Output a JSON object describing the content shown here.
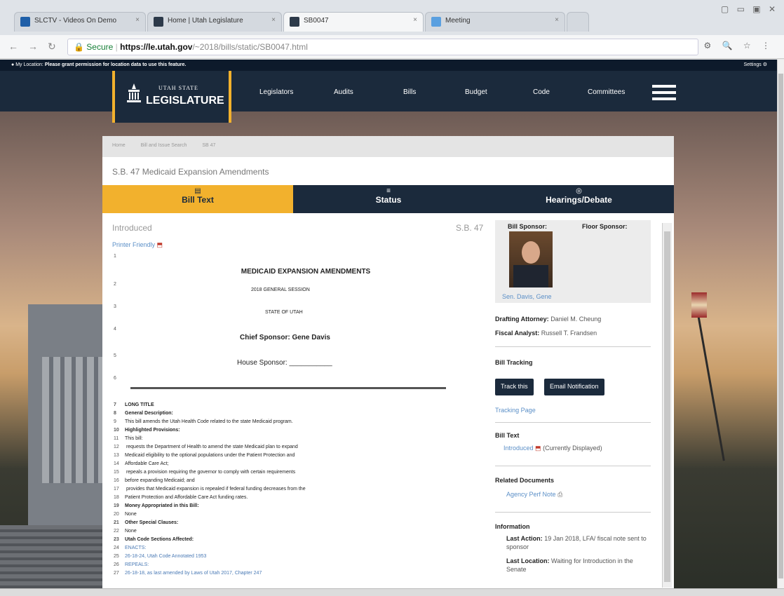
{
  "browser": {
    "tabs": [
      {
        "label": "SLCTV - Videos On Demo",
        "fav": "tv-icon"
      },
      {
        "label": "Home | Utah Legislature",
        "fav": "legislature-icon"
      },
      {
        "label": "SB0047",
        "fav": "legislature-icon"
      },
      {
        "label": "Meeting",
        "fav": "meeting-icon"
      }
    ],
    "url": {
      "secure": "Secure",
      "domain": "https://le.utah.gov",
      "path": "/~2018/bills/static/SB0047.html"
    }
  },
  "location_bar": {
    "label": "My Location:",
    "text": "Please grant permission for location data to use this feature.",
    "settings": "Settings"
  },
  "header": {
    "logo_top": "UTAH STATE",
    "logo_main": "LEGISLATURE",
    "menu": [
      "Legislators",
      "Audits",
      "Bills",
      "Budget",
      "Code",
      "Committees"
    ]
  },
  "breadcrumb": [
    "Home",
    "Bill and Issue Search",
    "SB 47"
  ],
  "bill": {
    "title": "S.B. 47 Medicaid Expansion Amendments"
  },
  "tabs": [
    {
      "label": "Bill Text",
      "icon": "document-icon"
    },
    {
      "label": "Status",
      "icon": "list-icon"
    },
    {
      "label": "Hearings/Debate",
      "icon": "globe-icon"
    }
  ],
  "content": {
    "status": "Introduced",
    "number": "S.B. 47",
    "printer": "Printer Friendly",
    "title": "MEDICAID EXPANSION AMENDMENTS",
    "session": "2018 GENERAL SESSION",
    "state": "STATE OF UTAH",
    "chief": "Chief Sponsor: Gene Davis",
    "house": "House Sponsor: ___________",
    "long_title": [
      {
        "n": "7",
        "t": "LONG TITLE",
        "b": true
      },
      {
        "n": "8",
        "t": "General Description:",
        "b": true
      },
      {
        "n": "9",
        "t": "This bill amends the Utah Health Code related to the state Medicaid program."
      },
      {
        "n": "10",
        "t": "Highlighted Provisions:",
        "b": true
      },
      {
        "n": "11",
        "t": "This bill:"
      },
      {
        "n": "12",
        "t": "   requests the Department of Health to amend the state Medicaid plan to expand"
      },
      {
        "n": "13",
        "t": "Medicaid eligibility to the optional populations under the Patient Protection and"
      },
      {
        "n": "14",
        "t": "Affordable Care Act;"
      },
      {
        "n": "15",
        "t": "   repeals a provision requiring the governor to comply with certain requirements"
      },
      {
        "n": "16",
        "t": "before expanding Medicaid; and"
      },
      {
        "n": "17",
        "t": "   provides that Medicaid expansion is repealed if federal funding decreases from the"
      },
      {
        "n": "18",
        "t": "Patient Protection and Affordable Care Act funding rates."
      },
      {
        "n": "19",
        "t": "Money Appropriated in this Bill:",
        "b": true
      },
      {
        "n": "20",
        "t": "None"
      },
      {
        "n": "21",
        "t": "Other Special Clauses:",
        "b": true
      },
      {
        "n": "22",
        "t": "None"
      },
      {
        "n": "23",
        "t": "Utah Code Sections Affected:",
        "b": true
      },
      {
        "n": "24",
        "t": "ENACTS:",
        "link": true
      },
      {
        "n": "25",
        "t": "26-18-24, Utah Code Annotated 1953",
        "link": true
      },
      {
        "n": "26",
        "t": "REPEALS:",
        "link": true
      },
      {
        "n": "27",
        "t": "26-18-18, as last amended by Laws of Utah 2017, Chapter 247",
        "link": true
      }
    ]
  },
  "sidebar": {
    "bill_sponsor": "Bill Sponsor:",
    "floor_sponsor": "Floor Sponsor:",
    "sponsor_name": "Sen. Davis, Gene",
    "drafting_label": "Drafting Attorney:",
    "drafting": "Daniel M. Cheung",
    "fiscal_label": "Fiscal Analyst:",
    "fiscal": "Russell T. Frandsen",
    "tracking_title": "Bill Tracking",
    "track_btn": "Track this",
    "email_btn": "Email Notification",
    "tracking_page": "Tracking Page",
    "bill_text_title": "Bill Text",
    "bill_text_link": "Introduced",
    "bill_text_note": "(Currently Displayed)",
    "related_title": "Related Documents",
    "related_link": "Agency Perf Note",
    "info_title": "Information",
    "last_action_label": "Last Action:",
    "last_action": "19 Jan 2018, LFA/ fiscal note sent to sponsor",
    "last_location_label": "Last Location:",
    "last_location": "Waiting for Introduction in the Senate"
  }
}
